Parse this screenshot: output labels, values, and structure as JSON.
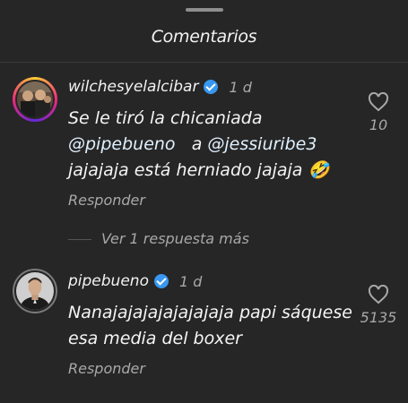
{
  "header": {
    "title": "Comentarios"
  },
  "comments": [
    {
      "username": "wilchesyelalcibar",
      "time": "1 d",
      "text_line1": "Se le tiró la chicaniada",
      "mention1": "@pipebueno",
      "text_mid": "a",
      "mention2": "@jessiuribe3",
      "text_line3": "jajajaja está herniado jajaja",
      "emoji": "🤣",
      "reply_label": "Responder",
      "likes": "10"
    },
    {
      "username": "pipebueno",
      "time": "1 d",
      "text_line1": "Nanajajajajajajajaja papi sáquese",
      "text_line2": "esa media del boxer",
      "reply_label": "Responder",
      "likes": "5135"
    }
  ],
  "view_more": "Ver 1 respuesta más",
  "colors": {
    "background": "#262626",
    "verified": "#3897f0",
    "secondary_text": "#a8a8a8"
  }
}
